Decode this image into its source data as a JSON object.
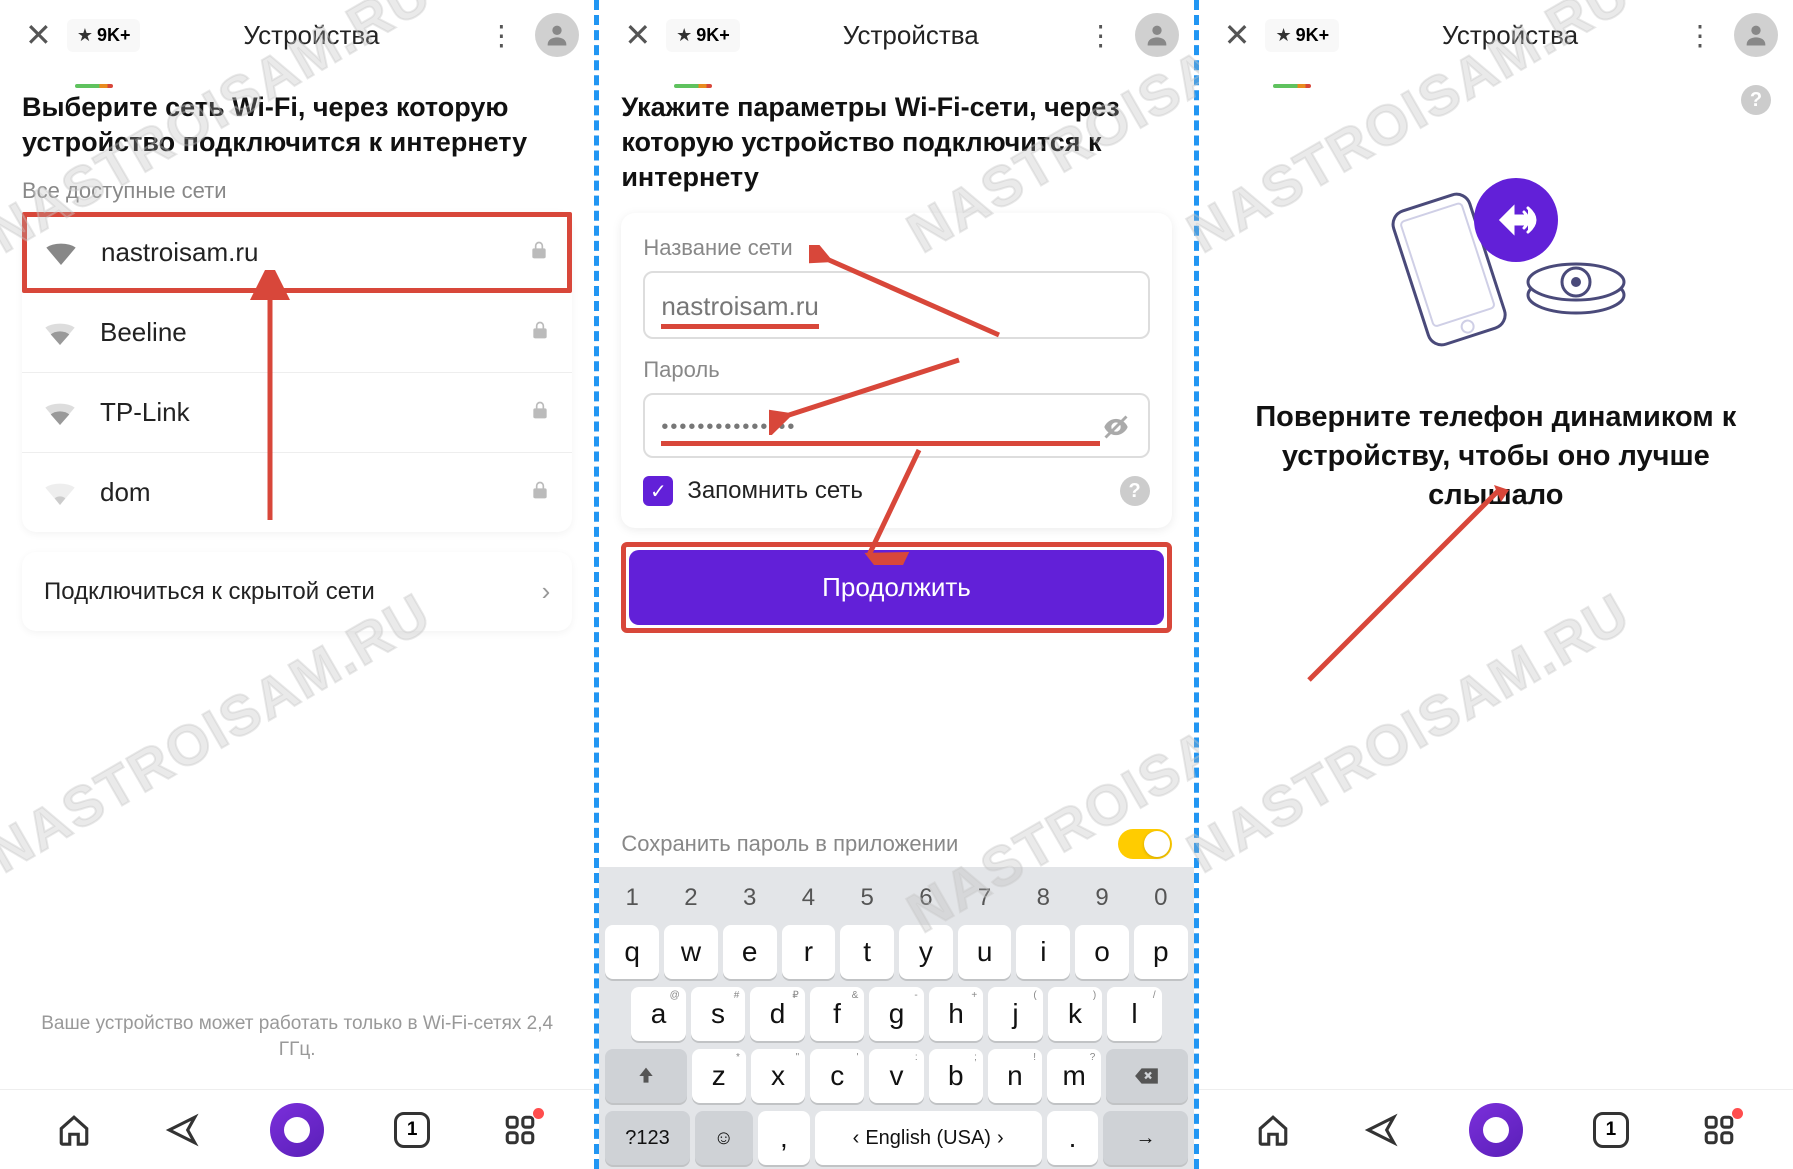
{
  "topbar": {
    "badge_text": "9K+",
    "title": "Устройства"
  },
  "screen1": {
    "heading": "Выберите сеть Wi-Fi, через которую устройство подключится к интернету",
    "subheading": "Все доступные сети",
    "networks": [
      {
        "name": "nastroisam.ru",
        "locked": true,
        "strength": "full",
        "highlighted": true
      },
      {
        "name": "Beeline",
        "locked": true,
        "strength": "med"
      },
      {
        "name": "TP-Link",
        "locked": true,
        "strength": "med"
      },
      {
        "name": "dom",
        "locked": true,
        "strength": "low"
      }
    ],
    "hidden_network": "Подключиться к скрытой сети",
    "footer": "Ваше устройство может работать только в Wi-Fi-сетях 2,4 ГГц."
  },
  "screen2": {
    "heading": "Укажите параметры Wi-Fi-сети, через которую устройство подключится к интернету",
    "network_label": "Название сети",
    "network_value": "nastroisam.ru",
    "password_label": "Пароль",
    "password_value": "•••••••••••••••",
    "remember": "Запомнить сеть",
    "continue": "Продолжить",
    "save_password": "Сохранить пароль в приложении",
    "keyboard": {
      "numbers": [
        "1",
        "2",
        "3",
        "4",
        "5",
        "6",
        "7",
        "8",
        "9",
        "0"
      ],
      "row1": [
        "q",
        "w",
        "e",
        "r",
        "t",
        "y",
        "u",
        "i",
        "o",
        "p"
      ],
      "row2": [
        "a",
        "s",
        "d",
        "f",
        "g",
        "h",
        "j",
        "k",
        "l"
      ],
      "row2_sup": [
        "@",
        "#",
        "₽",
        "&",
        "-",
        "+",
        "(",
        ")",
        "/"
      ],
      "row3": [
        "z",
        "x",
        "c",
        "v",
        "b",
        "n",
        "m"
      ],
      "row3_sup": [
        "*",
        "\"",
        "'",
        ":",
        ";",
        "!",
        "?"
      ],
      "sym": "?123",
      "lang": "English (USA)",
      "comma": ",",
      "dot": "."
    }
  },
  "screen3": {
    "instruction": "Поверните телефон динамиком к устройству, чтобы оно лучше слышало"
  },
  "bottombar": {
    "tabs_count": "1"
  },
  "watermark": "NASTROISAM.RU"
}
